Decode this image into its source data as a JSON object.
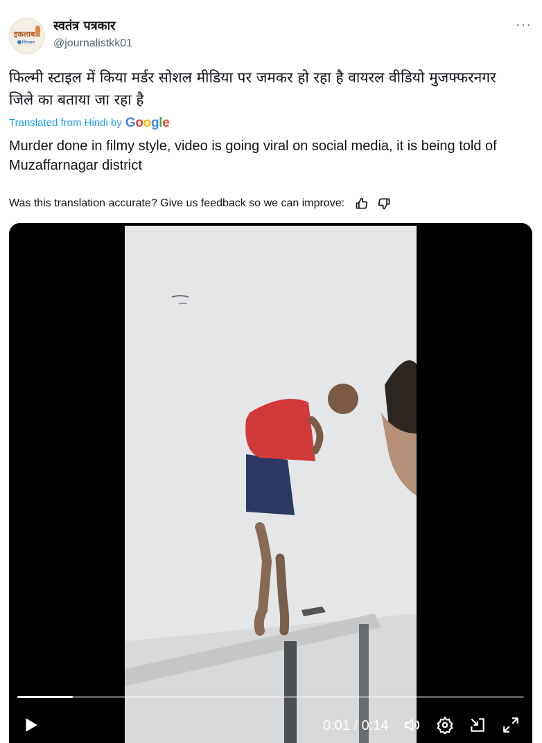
{
  "header": {
    "avatar_logo_text": "इकलाब",
    "avatar_logo_subtext": "जियाकर",
    "display_name": "स्वतंत्र पत्रकार",
    "handle": "@journalistkk01",
    "more_icon": "more-horizontal-icon",
    "more_label": "···"
  },
  "tweet": {
    "text_hindi": "फिल्मी स्टाइल में किया मर्डर सोशल मीडिया पर जमकर हो रहा है वायरल वीडियो मुजफ्फरनगर जिले का बताया जा रहा है",
    "translated_label": "Translated from Hindi by",
    "translation": "Murder done in filmy style, video is going viral on social media, it is being told of Muzaffarnagar district",
    "feedback_prompt": "Was this translation accurate? Give us feedback so we can improve:",
    "thumbs_up_icon": "thumbs-up-icon",
    "thumbs_down_icon": "thumbs-down-icon"
  },
  "google_logo": [
    "G",
    "o",
    "o",
    "g",
    "l",
    "e"
  ],
  "video": {
    "progress_fraction": 0.11,
    "current_time": "0:01",
    "separator": "/",
    "duration": "0:14",
    "time_display": "0:01 / 0:14",
    "icons": [
      "play-icon",
      "volume-icon",
      "settings-icon",
      "minimize-icon",
      "fullscreen-icon"
    ]
  }
}
